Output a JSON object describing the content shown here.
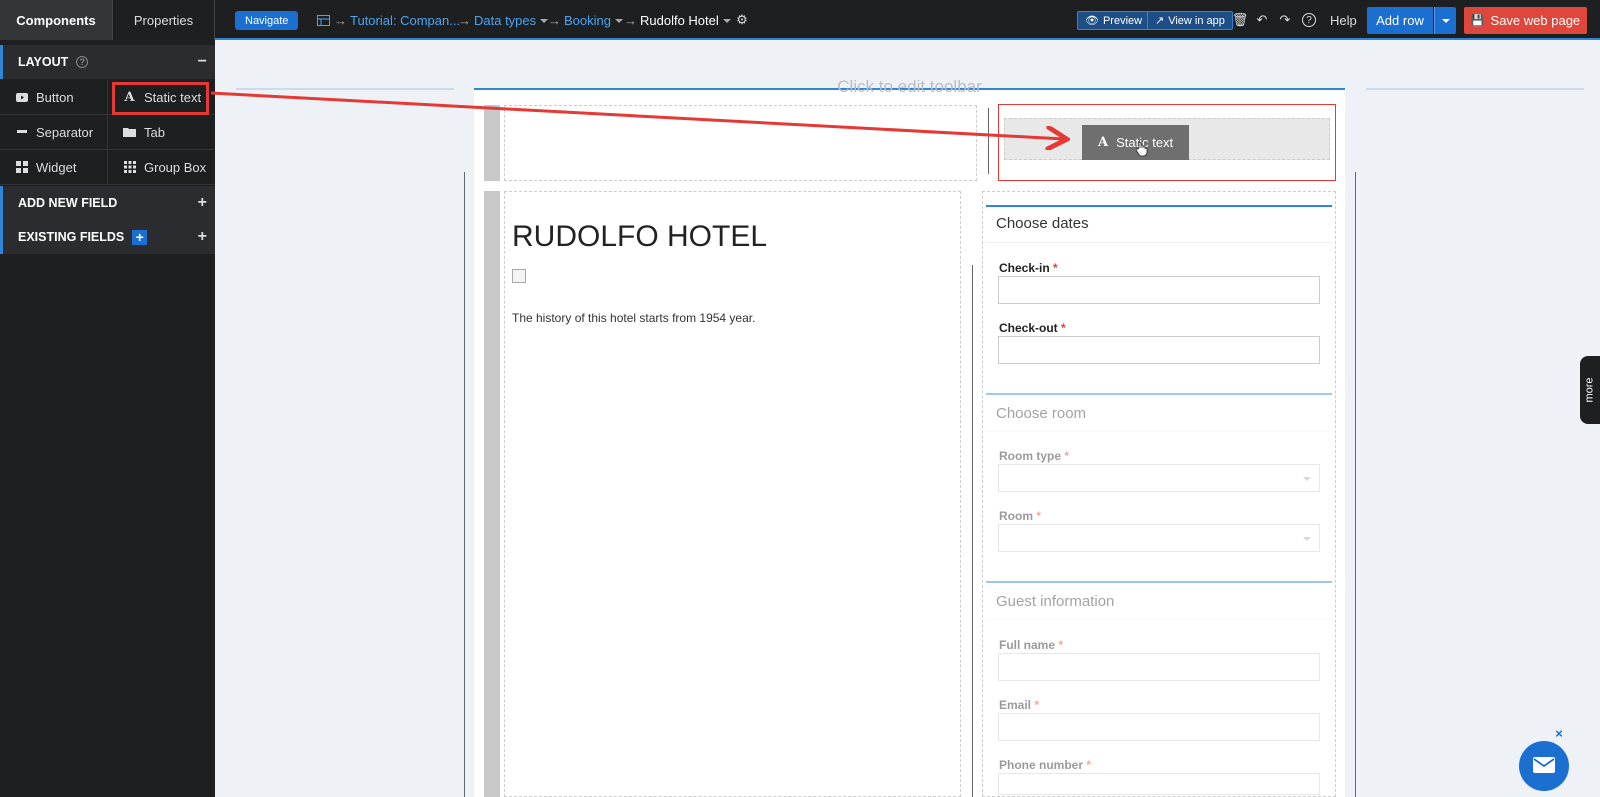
{
  "sidebar": {
    "tabs": [
      "Components",
      "Properties"
    ],
    "layout_title": "LAYOUT",
    "components": [
      {
        "label": "Button",
        "icon": "youtube-icon"
      },
      {
        "label": "Static text",
        "icon": "font-icon"
      },
      {
        "label": "Separator",
        "icon": "minus-icon"
      },
      {
        "label": "Tab",
        "icon": "folder-icon"
      },
      {
        "label": "Widget",
        "icon": "widget-icon"
      },
      {
        "label": "Group Box",
        "icon": "grid-icon"
      }
    ],
    "add_new_field": "ADD NEW FIELD",
    "existing_fields": "EXISTING FIELDS"
  },
  "topbar": {
    "navigate": "Navigate",
    "breadcrumbs": [
      "Tutorial: Compan...",
      "Data types",
      "Booking",
      "Rudolfo Hotel"
    ],
    "preview": "Preview",
    "view_in_app": "View in app",
    "help": "Help",
    "add_row": "Add row",
    "save": "Save web page"
  },
  "canvas": {
    "toolbar_hint": "Click to edit toolbar",
    "drag_label": "Static text",
    "hotel_title": "RUDOLFO HOTEL",
    "history": "The history of this hotel starts from 1954 year.",
    "sections": [
      {
        "title": "Choose dates",
        "fields": [
          "Check-in",
          "Check-out"
        ]
      },
      {
        "title": "Choose room",
        "fields": [
          "Room type",
          "Room"
        ]
      },
      {
        "title": "Guest information",
        "fields": [
          "Full name",
          "Email",
          "Phone number"
        ]
      }
    ],
    "required_mark": "*",
    "more_tab": "more"
  },
  "colors": {
    "accent": "#2f86d6",
    "save": "#e0473c",
    "highlight": "#e53935"
  }
}
